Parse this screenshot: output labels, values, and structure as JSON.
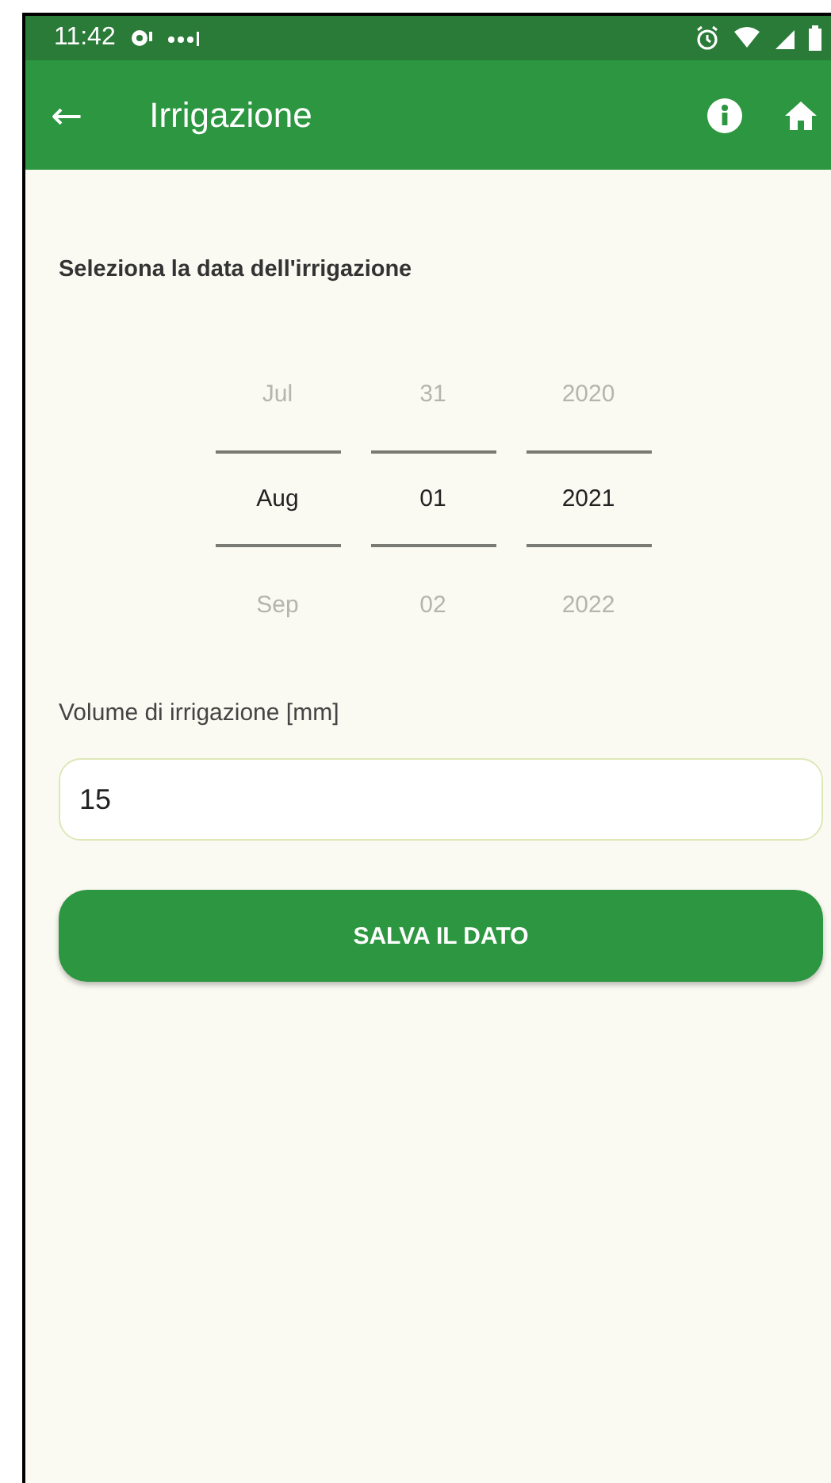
{
  "status_bar": {
    "time": "11:42"
  },
  "app_bar": {
    "back": "←",
    "title": "Irrigazione"
  },
  "heading": "Seleziona la data dell'irrigazione",
  "date_picker": {
    "columns": [
      {
        "items": [
          {
            "label": "Jul",
            "selected": false
          },
          {
            "label": "Aug",
            "selected": true
          },
          {
            "label": "Sep",
            "selected": false
          }
        ]
      },
      {
        "items": [
          {
            "label": "31",
            "selected": false
          },
          {
            "label": "01",
            "selected": true
          },
          {
            "label": "02",
            "selected": false
          }
        ]
      },
      {
        "items": [
          {
            "label": "2020",
            "selected": false
          },
          {
            "label": "2021",
            "selected": true
          },
          {
            "label": "2022",
            "selected": false
          }
        ]
      }
    ]
  },
  "volume": {
    "label": "Volume di irrigazione [mm]",
    "value": "15"
  },
  "buttons": [
    "SALVA IL DATO"
  ]
}
